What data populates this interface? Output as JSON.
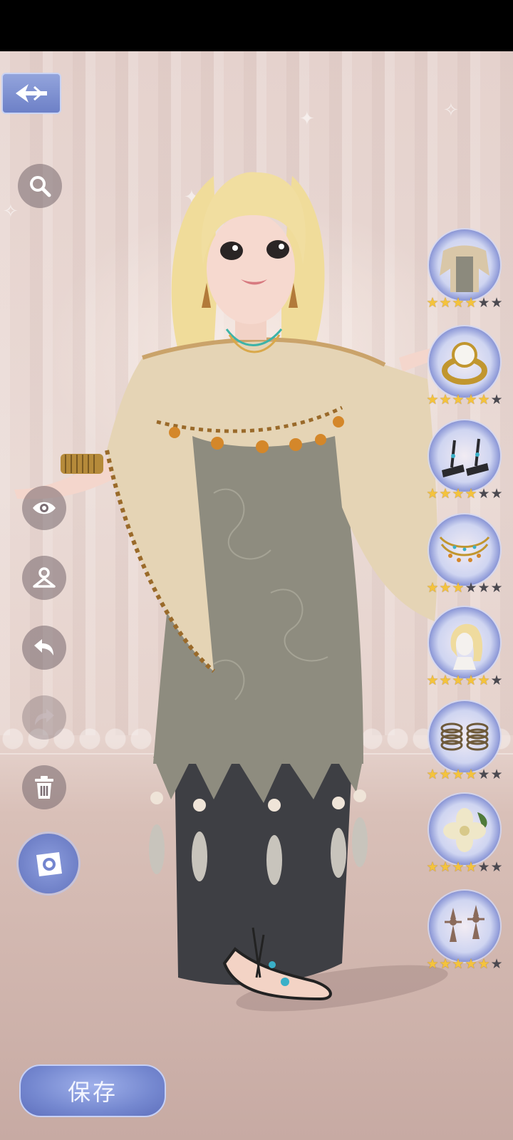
{
  "toolbar": {
    "back": {
      "icon": "back-arrow-icon"
    },
    "search": {
      "icon": "search-icon"
    },
    "visibility": {
      "icon": "eye-icon"
    },
    "wardrobe": {
      "icon": "hanger-icon"
    },
    "undo": {
      "icon": "undo-icon"
    },
    "redo": {
      "icon": "redo-icon",
      "enabled": false
    },
    "delete": {
      "icon": "trash-icon"
    },
    "camera": {
      "icon": "camera-icon"
    }
  },
  "outfit_items": [
    {
      "icon": "shawl-dress-icon",
      "rating": 4,
      "max_rating": 6
    },
    {
      "icon": "pearl-ring-icon",
      "rating": 5,
      "max_rating": 6
    },
    {
      "icon": "sandals-icon",
      "rating": 4,
      "max_rating": 6
    },
    {
      "icon": "necklace-icon",
      "rating": 3,
      "max_rating": 6
    },
    {
      "icon": "hairstyle-icon",
      "rating": 5,
      "max_rating": 6
    },
    {
      "icon": "bracelets-icon",
      "rating": 4,
      "max_rating": 6
    },
    {
      "icon": "flower-hairpin-icon",
      "rating": 4,
      "max_rating": 6
    },
    {
      "icon": "earrings-icon",
      "rating": 5,
      "max_rating": 6
    }
  ],
  "save_button": {
    "label": "保存"
  },
  "colors": {
    "accent": "#7385cf",
    "star_on": "#f4c33c",
    "star_off": "#4b4950"
  }
}
